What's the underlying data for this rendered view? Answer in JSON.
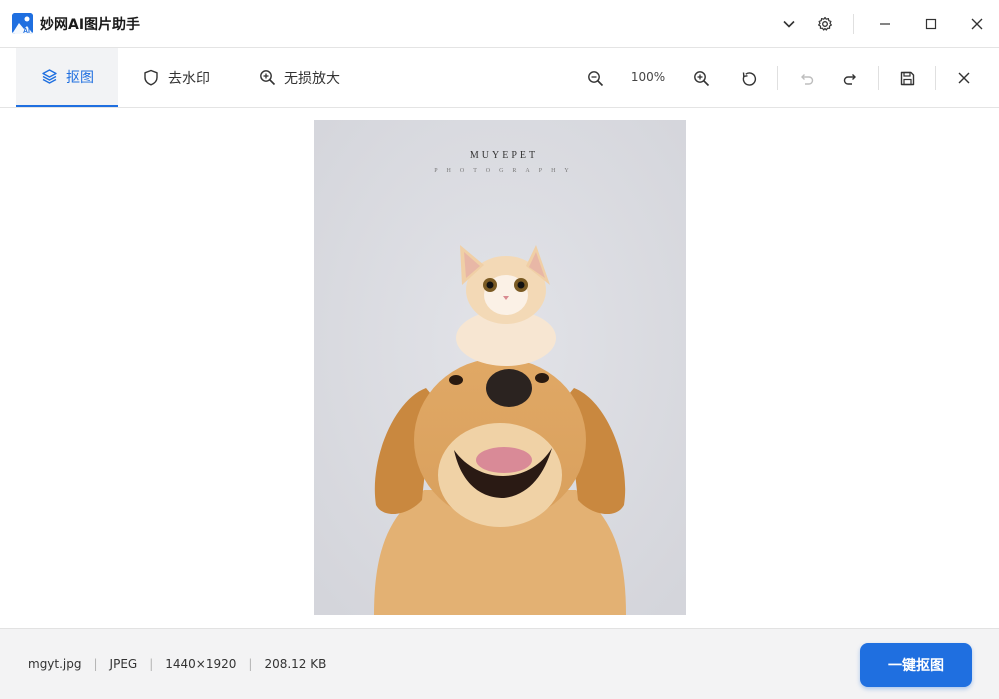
{
  "app": {
    "title": "妙网AI图片助手",
    "accent_color": "#1f6fe0"
  },
  "titlebar": {
    "icons": [
      "chevron-down-icon",
      "gear-icon",
      "minimize-icon",
      "maximize-icon",
      "close-icon"
    ]
  },
  "tabs": [
    {
      "label": "抠图",
      "icon": "layers-icon",
      "active": true
    },
    {
      "label": "去水印",
      "icon": "shield-icon",
      "active": false
    },
    {
      "label": "无损放大",
      "icon": "zoom-in-icon",
      "active": false
    }
  ],
  "tools": {
    "zoom_level": "100%",
    "icons": [
      "zoom-out-icon",
      "zoom-in-icon",
      "rotate-icon",
      "undo-icon",
      "redo-icon",
      "save-icon",
      "close-icon"
    ],
    "undo_disabled": true
  },
  "image": {
    "watermark_title": "MUYEPET",
    "watermark_subtitle": "PHOTOGRAPHY"
  },
  "status": {
    "filename": "mgyt.jpg",
    "format": "JPEG",
    "dimensions": "1440×1920",
    "filesize": "208.12 KB"
  },
  "actions": {
    "primary_label": "一键抠图"
  }
}
